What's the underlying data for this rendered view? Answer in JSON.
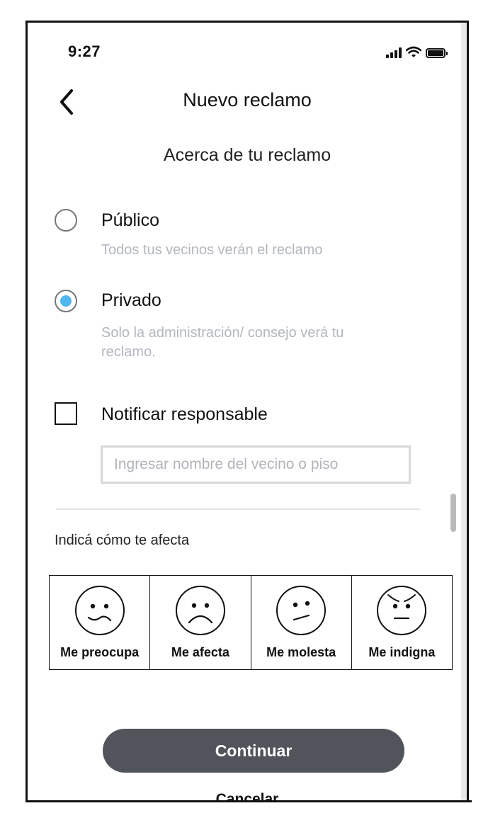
{
  "status_bar": {
    "time": "9:27"
  },
  "header": {
    "title": "Nuevo reclamo",
    "back_icon": "chevron-left-icon"
  },
  "section": {
    "subtitle": "Acerca de tu reclamo"
  },
  "visibility": {
    "options": [
      {
        "label": "Público",
        "description": "Todos tus vecinos verán el reclamo",
        "selected": false
      },
      {
        "label": "Privado",
        "description": "Solo la administración/ consejo verá tu reclamo.",
        "selected": true
      }
    ],
    "selected_color": "#4fb6ee"
  },
  "notify": {
    "label": "Notificar responsable",
    "checked": false,
    "input_placeholder": "Ingresar nombre del vecino o piso",
    "input_value": ""
  },
  "affect": {
    "label": "Indicá cómo te afecta",
    "options": [
      {
        "label": "Me preocupa",
        "icon": "worried-face-icon"
      },
      {
        "label": "Me afecta",
        "icon": "sad-face-icon"
      },
      {
        "label": "Me molesta",
        "icon": "annoyed-face-icon"
      },
      {
        "label": "Me indigna",
        "icon": "angry-face-icon"
      }
    ]
  },
  "actions": {
    "continue_label": "Continuar",
    "cancel_label": "Cancelar",
    "continue_color": "#51555b"
  }
}
